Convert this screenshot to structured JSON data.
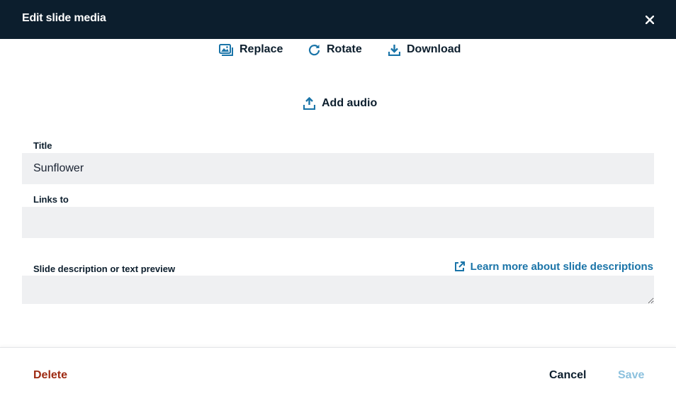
{
  "header": {
    "title": "Edit slide media",
    "close_icon": "close-icon"
  },
  "toolbar": {
    "replace_label": "Replace",
    "rotate_label": "Rotate",
    "download_label": "Download",
    "add_audio_label": "Add audio"
  },
  "form": {
    "title_label": "Title",
    "title_value": "Sunflower",
    "links_label": "Links to",
    "links_value": "",
    "description_label": "Slide description or text preview",
    "description_value": "",
    "learn_more_label": "Learn more about slide descriptions"
  },
  "footer": {
    "delete_label": "Delete",
    "cancel_label": "Cancel",
    "save_label": "Save"
  },
  "colors": {
    "header_bg": "#0c1e2d",
    "accent": "#1a74a8",
    "danger": "#9e2a12",
    "disabled": "#8cc1de",
    "field_bg": "#eff0f2"
  }
}
